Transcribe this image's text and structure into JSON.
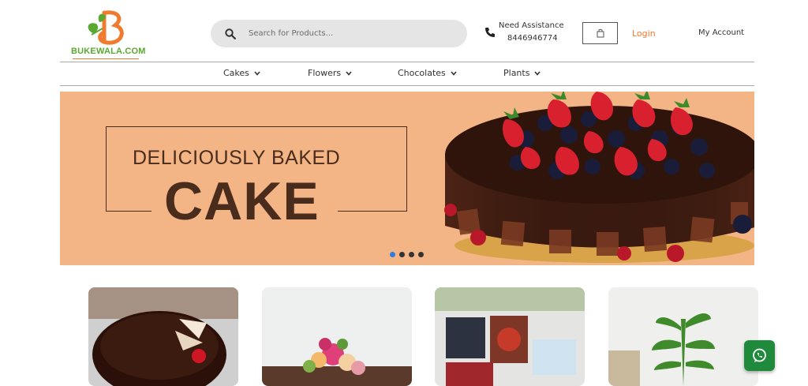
{
  "logo": {
    "text": "BUKEWALA.COM",
    "icon": "bukewala-logo-icon"
  },
  "search": {
    "placeholder": "Search for Products...",
    "value": "",
    "icon": "search-icon"
  },
  "assistance": {
    "title": "Need Assistance",
    "phone": "8446946774",
    "icon": "phone-icon"
  },
  "cart": {
    "icon": "shopping-bag-icon"
  },
  "login": {
    "label": "Login"
  },
  "account": {
    "label": "My Account"
  },
  "nav": {
    "items": [
      {
        "label": "Cakes",
        "icon": "chevron-down-icon"
      },
      {
        "label": "Flowers",
        "icon": "chevron-down-icon"
      },
      {
        "label": "Chocolates",
        "icon": "chevron-down-icon"
      },
      {
        "label": "Plants",
        "icon": "chevron-down-icon"
      }
    ]
  },
  "banner": {
    "line1": "DELICIOUSLY BAKED",
    "line2": "CAKE",
    "slides": 4,
    "active_slide": 1
  },
  "cards": [
    {
      "name": "chocolate-cake"
    },
    {
      "name": "flower-bouquet"
    },
    {
      "name": "photo-frames"
    },
    {
      "name": "lucky-bamboo-plant"
    }
  ],
  "whatsapp": {
    "icon": "whatsapp-icon"
  },
  "colors": {
    "accent": "#f07a2e",
    "brand_green": "#5aa832",
    "banner_bg": "#f4b586",
    "text_brown": "#4a2c1c",
    "whatsapp": "#1f8a3b"
  }
}
